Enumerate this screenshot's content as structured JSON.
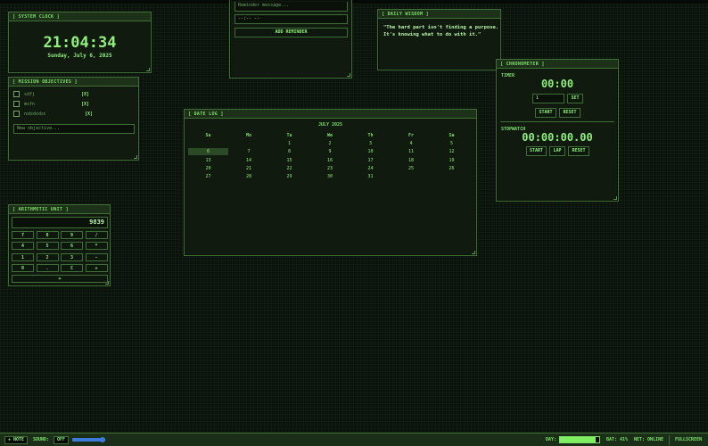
{
  "clock": {
    "title": "[ SYSTEM CLOCK ]",
    "time": "21:04:34",
    "date": "Sunday, July 6, 2025"
  },
  "reminder": {
    "message_placeholder": "Reminder message...",
    "time_value": "--:-- --",
    "add_label": "ADD REMINDER"
  },
  "wisdom": {
    "title": "[ DAILY WISDOM ]",
    "quote_line1": "\"The hard part isn't finding a purpose.",
    "quote_line2": "It's knowing what to do with it.\""
  },
  "objectives": {
    "title": "[ MISSION OBJECTIVES ]",
    "items": [
      {
        "text": "sdfj",
        "remove": "[X]"
      },
      {
        "text": "msfn",
        "remove": "[X]"
      },
      {
        "text": "nxbxbxbx",
        "remove": "[X]"
      }
    ],
    "input_placeholder": "New objective..."
  },
  "chronometer": {
    "title": "[ CHRONOMETER ]",
    "timer_label": "TIMER",
    "timer_display": "00:00",
    "timer_input": "1",
    "set_label": "SET",
    "start_label": "START",
    "reset_label": "RESET",
    "stopwatch_label": "STOPWATCH",
    "stopwatch_display": "00:00:00.00",
    "sw_start_label": "START",
    "sw_lap_label": "LAP",
    "sw_reset_label": "RESET"
  },
  "calendar": {
    "title": "[ DATE LOG ]",
    "month": "JULY 2025",
    "weekdays": [
      "Su",
      "Mo",
      "Tu",
      "We",
      "Th",
      "Fr",
      "Sa"
    ],
    "first_weekday": 2,
    "days_in_month": 31,
    "today": 6
  },
  "calculator": {
    "title": "[ ARITHMETIC UNIT ]",
    "display": "9839",
    "keys": [
      "7",
      "8",
      "9",
      "/",
      "4",
      "5",
      "6",
      "*",
      "1",
      "2",
      "3",
      "-",
      "0",
      ".",
      "C",
      "+"
    ],
    "equals": "="
  },
  "taskbar": {
    "note_label": "+ NOTE",
    "sound_label": "SOUND:",
    "sound_state": "OFF",
    "volume": 0.95,
    "day_label": "DAY:",
    "day_progress": 0.92,
    "bat_text": "BAT: 41%",
    "net_text": "NET: ONLINE",
    "fullscreen_label": "FULLSCREEN"
  }
}
